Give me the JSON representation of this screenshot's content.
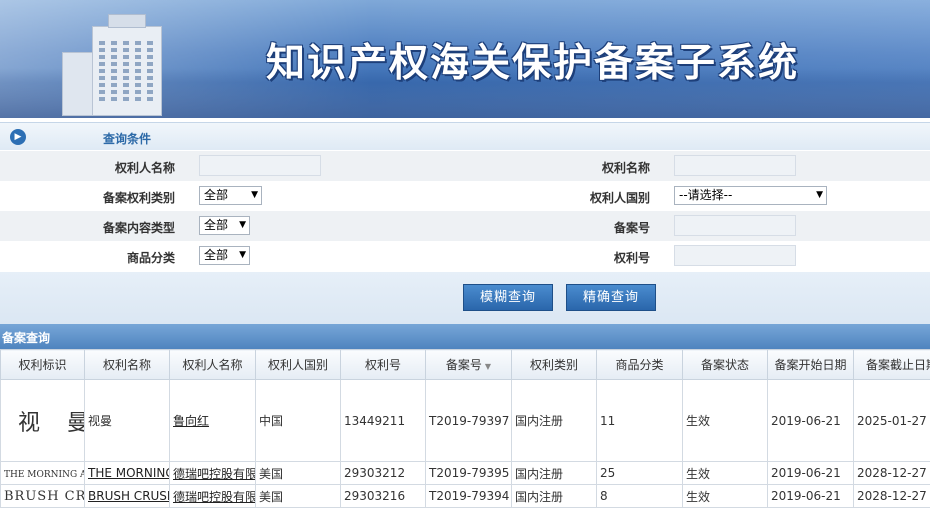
{
  "banner": {
    "title": "知识产权海关保护备案子系统"
  },
  "query": {
    "header": "查询条件",
    "fields": {
      "holder_name": {
        "label": "权利人名称"
      },
      "right_name": {
        "label": "权利名称"
      },
      "right_type": {
        "label": "备案权利类别",
        "value": "全部"
      },
      "holder_country": {
        "label": "权利人国别",
        "value": "--请选择--"
      },
      "content_type": {
        "label": "备案内容类型",
        "value": "全部"
      },
      "record_no": {
        "label": "备案号"
      },
      "goods_class": {
        "label": "商品分类",
        "value": "全部"
      },
      "right_no": {
        "label": "权利号"
      }
    },
    "buttons": {
      "fuzzy": "模糊查询",
      "exact": "精确查询"
    }
  },
  "results": {
    "header": "备案查询",
    "columns": [
      "权利标识",
      "权利名称",
      "权利人名称",
      "权利人国别",
      "权利号",
      "备案号",
      "权利类别",
      "商品分类",
      "备案状态",
      "备案开始日期",
      "备案截止日期"
    ],
    "rows": [
      {
        "mark": "视 曼",
        "name": "视曼",
        "holder": "鲁向红",
        "country": "中国",
        "right_no": "13449211",
        "record_no": "T2019-79397",
        "type": "国内注册",
        "goods": "11",
        "status": "生效",
        "start": "2019-06-21",
        "end": "2025-01-27"
      },
      {
        "mark": "THE MORNING AF",
        "name": "THE MORNING",
        "holder": "德瑞吧控股有限",
        "country": "美国",
        "right_no": "29303212",
        "record_no": "T2019-79395",
        "type": "国内注册",
        "goods": "25",
        "status": "生效",
        "start": "2019-06-21",
        "end": "2028-12-27"
      },
      {
        "mark": "BRUSH CRU",
        "name": "BRUSH CRUSH",
        "holder": "德瑞吧控股有限",
        "country": "美国",
        "right_no": "29303216",
        "record_no": "T2019-79394",
        "type": "国内注册",
        "goods": "8",
        "status": "生效",
        "start": "2019-06-21",
        "end": "2028-12-27"
      }
    ]
  }
}
